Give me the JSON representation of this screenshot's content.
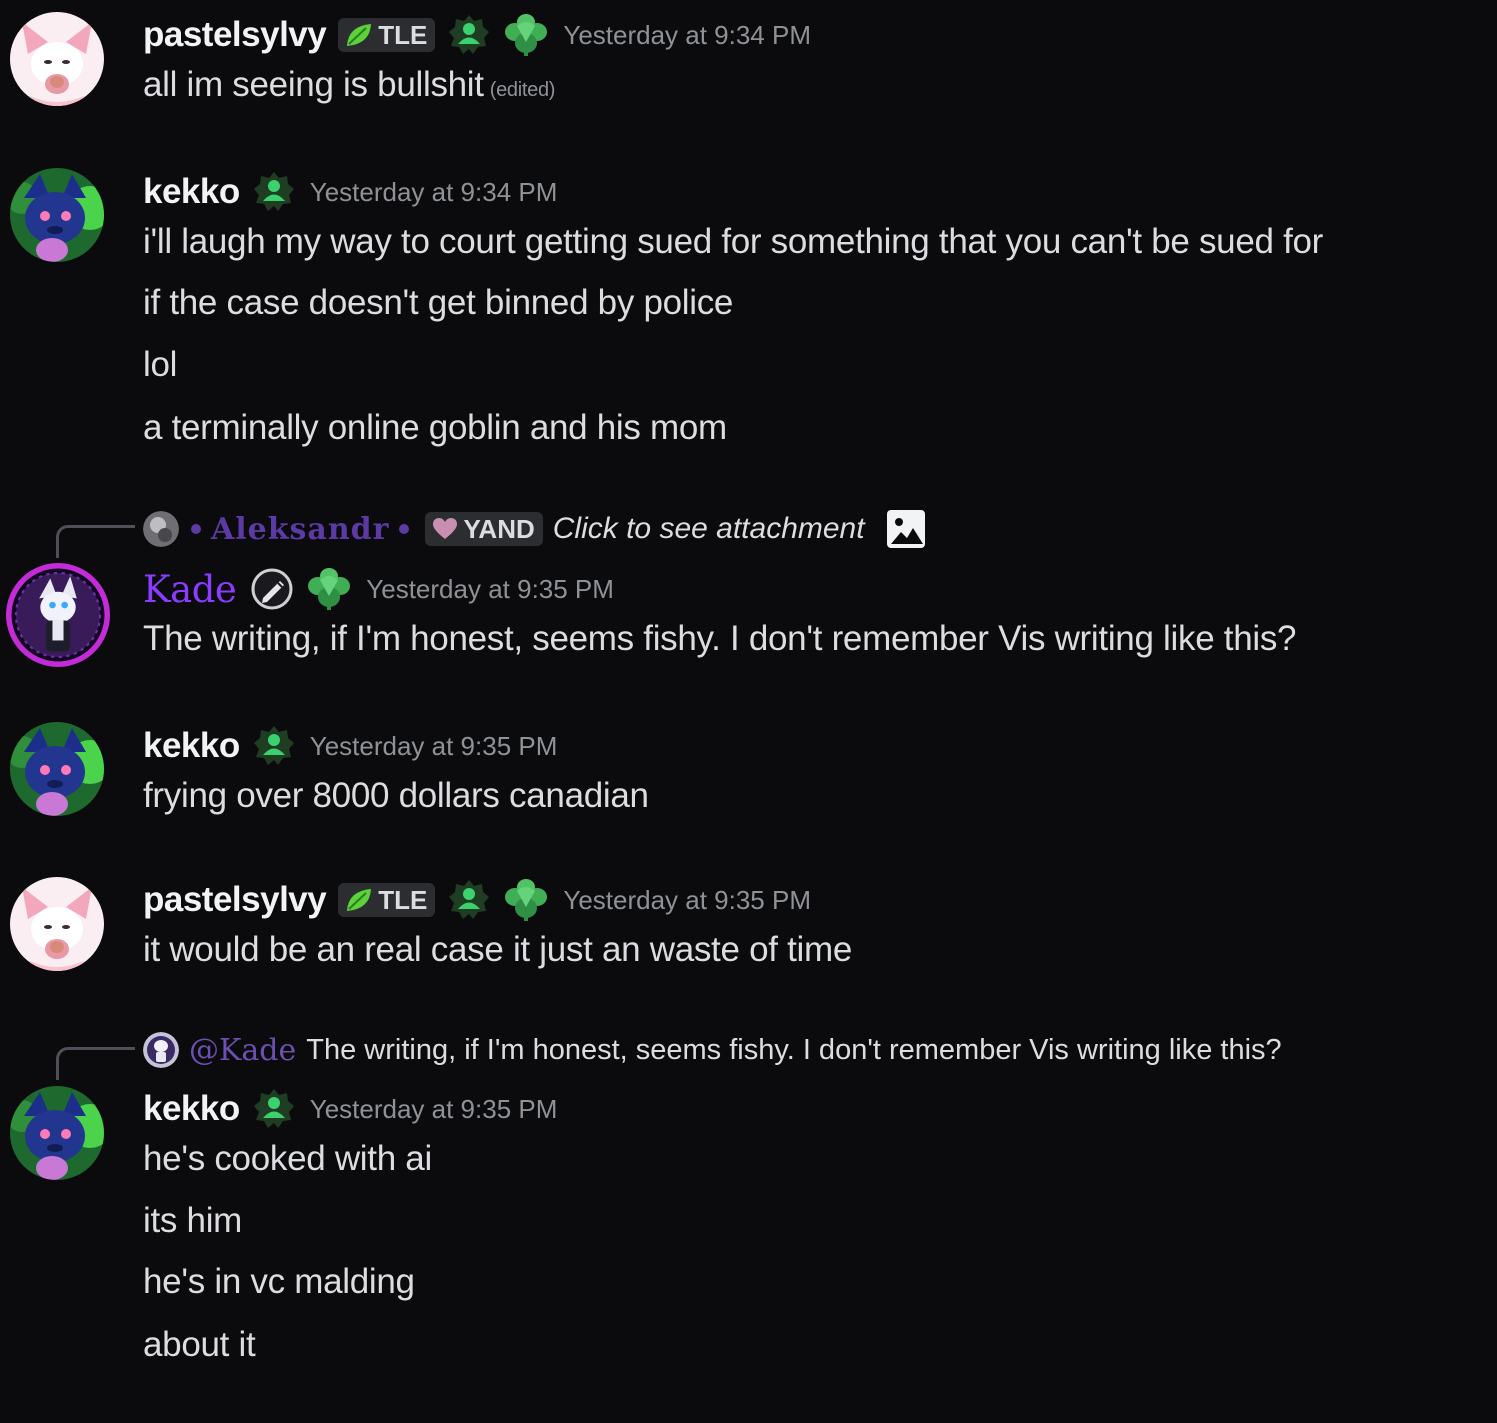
{
  "colors": {
    "background": "#0b0b0d",
    "text": "#dcdde1",
    "timestamp": "#8e9297",
    "kade_name": "#8a3cff",
    "reply_name": "#5b3aa3",
    "badge_green": "#3bd16f"
  },
  "messages": [
    {
      "username": "pastelsylvy",
      "tag": "TLE",
      "timestamp": "Yesterday at 9:34 PM",
      "lines": [
        "all im seeing is bullshit"
      ],
      "edited_label": "(edited)"
    },
    {
      "username": "kekko",
      "timestamp": "Yesterday at 9:34 PM",
      "lines": [
        "i'll laugh my way to court getting sued for something that you can't be sued for",
        "if the case doesn't get binned by police",
        "lol",
        "a terminally online goblin and his mom"
      ]
    },
    {
      "reply": {
        "name": "Aleksandr",
        "tag": "YAND",
        "text": "Click to see attachment"
      },
      "username": "Kade",
      "timestamp": "Yesterday at 9:35 PM",
      "lines": [
        "The writing, if I'm honest, seems fishy. I don't remember Vis writing like this?"
      ]
    },
    {
      "username": "kekko",
      "timestamp": "Yesterday at 9:35 PM",
      "lines": [
        "frying over 8000 dollars canadian"
      ]
    },
    {
      "username": "pastelsylvy",
      "tag": "TLE",
      "timestamp": "Yesterday at 9:35 PM",
      "lines": [
        "it would be an real case it just an waste of time"
      ]
    },
    {
      "reply": {
        "mention": "@Kade",
        "text": "The writing, if I'm honest, seems fishy. I don't remember Vis writing like this?"
      },
      "username": "kekko",
      "timestamp": "Yesterday at 9:35 PM",
      "lines": [
        "he's cooked with ai",
        "its him",
        "he's in vc malding",
        "about it"
      ]
    }
  ]
}
